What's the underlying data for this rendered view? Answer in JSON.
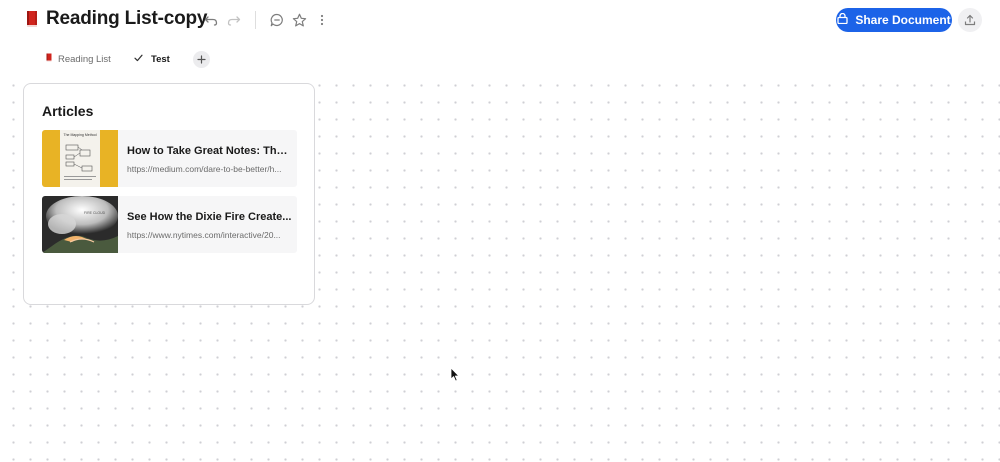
{
  "document": {
    "title": "Reading List-copy"
  },
  "header": {
    "share_label": "Share Document",
    "icons": [
      "book-icon",
      "undo-icon",
      "redo-icon",
      "comment-icon",
      "star-icon",
      "more-icon",
      "lock-icon",
      "export-icon"
    ]
  },
  "tabs": [
    {
      "label": "Reading List",
      "icon": "book-icon",
      "active": false
    },
    {
      "label": "Test",
      "icon": "check-icon",
      "active": true
    }
  ],
  "card": {
    "title": "Articles",
    "articles": [
      {
        "title": "How to Take Great Notes: The ...",
        "url": "https://medium.com/dare-to-be-better/h...",
        "thumb_caption": "The Mapping Method",
        "thumb_color": "#e8b325"
      },
      {
        "title": "See How the Dixie Fire Create...",
        "url": "https://www.nytimes.com/interactive/20...",
        "thumb_caption": "FIRE CLOUD",
        "thumb_color": "#2b2b2b"
      }
    ]
  },
  "colors": {
    "accent": "#1c63e8",
    "book": "#d0241d",
    "card_border": "#d9d9dc"
  }
}
